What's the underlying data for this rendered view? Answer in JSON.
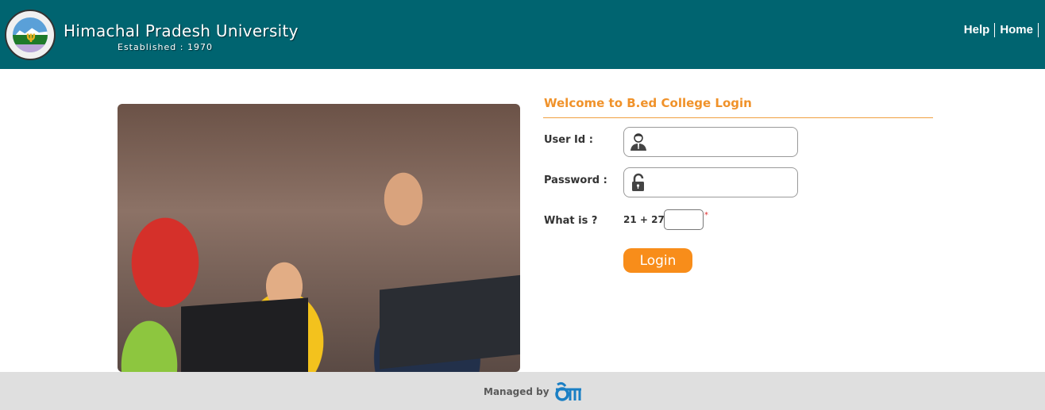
{
  "header": {
    "title": "Himachal Pradesh University",
    "subtitle": "Established : 1970",
    "logo_icon": "university-emblem-icon",
    "nav": [
      {
        "label": "Help"
      },
      {
        "label": "Home"
      }
    ],
    "colors": {
      "background": "#006470",
      "text": "#ffffff"
    }
  },
  "hero_image": {
    "description": "students-with-laptops-photo"
  },
  "login_form": {
    "title": "Welcome to B.ed College Login",
    "user_id": {
      "label": "User Id :",
      "value": "",
      "placeholder": "",
      "icon": "user-icon"
    },
    "password": {
      "label": "Password :",
      "value": "",
      "placeholder": "",
      "icon": "lock-icon"
    },
    "captcha": {
      "label": "What is ?",
      "question": "21 + 27",
      "value": "",
      "required_mark": "*"
    },
    "submit_label": "Login",
    "colors": {
      "accent": "#f0922a",
      "button": "#f88d1a"
    }
  },
  "footer": {
    "managed_by": "Managed by",
    "logo_icon": "cdac-logo-icon",
    "background": "#dfdfdf"
  }
}
